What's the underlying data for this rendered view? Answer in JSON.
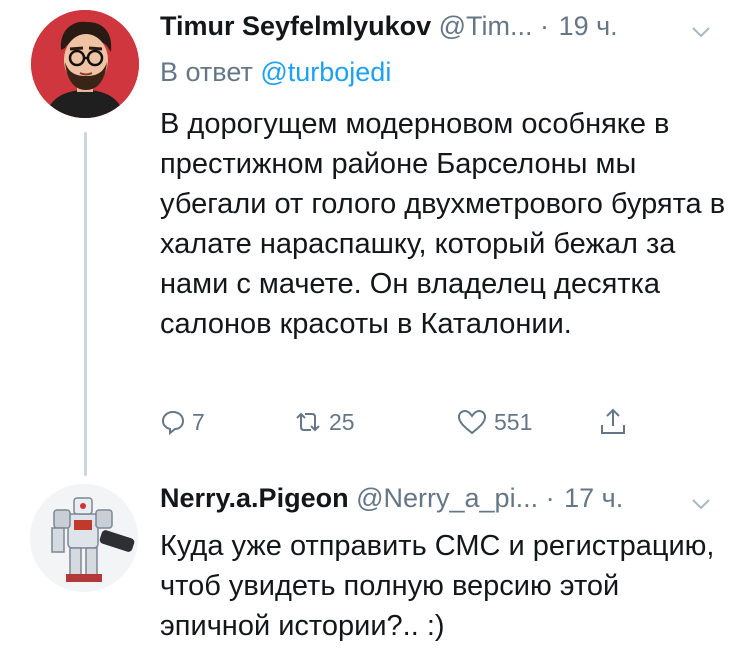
{
  "tweets": [
    {
      "author_name": "Timur Seyfelmlyukov",
      "handle": "@Tim...",
      "separator": "·",
      "time": "19 ч.",
      "reply_prefix": "В ответ",
      "reply_to": "@turbojedi",
      "text": "В дорогущем модерновом особняке в престижном районе Барселоны мы убегали от голого двухметрового бурята в халате нараспашку, который бежал за нами с мачете. Он владелец десятка салонов красоты в Каталонии.",
      "counts": {
        "replies": "7",
        "retweets": "25",
        "likes": "551"
      },
      "avatar": "illustrated-man-red-background-avatar"
    },
    {
      "author_name": "Nerry.a.Pigeon",
      "handle": "@Nerry_a_pi...",
      "separator": "·",
      "time": "17 ч.",
      "text": "Куда уже отправить СМС и регистрацию, чтоб увидеть полную версию этой эпичной истории?.. :)",
      "avatar": "robot-mech-avatar"
    }
  ],
  "icons": {
    "reply": "reply-icon",
    "retweet": "retweet-icon",
    "like": "heart-icon",
    "share": "share-icon",
    "menu": "chevron-down-icon"
  },
  "colors": {
    "text": "#14171a",
    "secondary": "#657786",
    "link": "#1da1f2",
    "thread_line": "#ccd6dd",
    "avatar_bg": "#d0363d"
  }
}
